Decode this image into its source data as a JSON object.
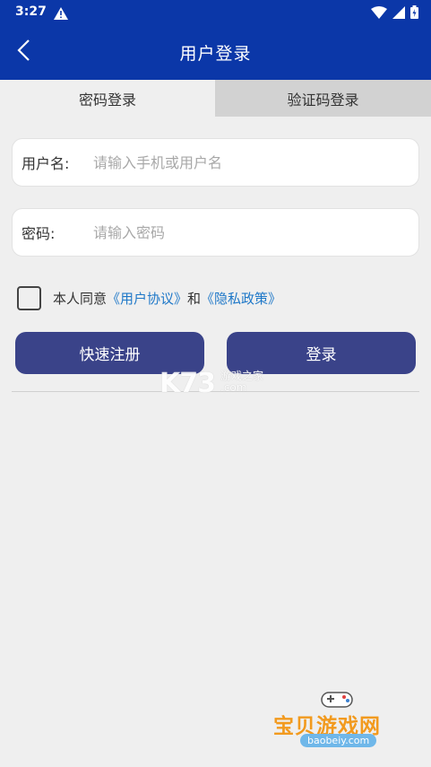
{
  "status_bar": {
    "time": "3:27"
  },
  "app_bar": {
    "title": "用户登录",
    "back_icon": "chevron-left-icon"
  },
  "tabs": [
    {
      "label": "密码登录",
      "active": true
    },
    {
      "label": "验证码登录",
      "active": false
    }
  ],
  "form": {
    "username": {
      "label": "用户名:",
      "placeholder": "请输入手机或用户名",
      "value": ""
    },
    "password": {
      "label": "密码:",
      "placeholder": "请输入密码",
      "value": ""
    }
  },
  "agreement": {
    "checked": false,
    "prefix": "本人同意",
    "user_agreement": "《用户协议》",
    "conjunction": "和",
    "privacy_policy": "《隐私政策》"
  },
  "buttons": {
    "register": "快速注册",
    "login": "登录"
  },
  "watermarks": {
    "k73": "K73",
    "k73_sub": "游戏之家",
    "k73_domain": ".com",
    "baobei": "宝贝游戏网",
    "baobei_url": "baobeiy.com"
  },
  "colors": {
    "primary": "#0b37a8",
    "button": "#3a4389",
    "link": "#1f78c8",
    "background": "#efefef",
    "tab_inactive": "#d2d2d2"
  }
}
